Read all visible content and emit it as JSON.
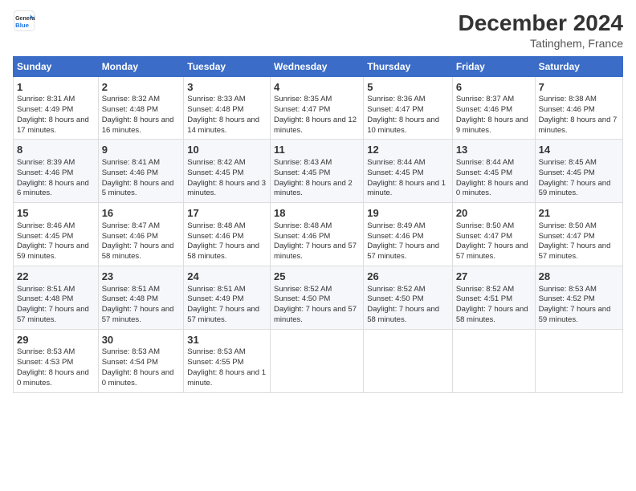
{
  "header": {
    "logo_line1": "General",
    "logo_line2": "Blue",
    "title": "December 2024",
    "subtitle": "Tatinghem, France"
  },
  "days_of_week": [
    "Sunday",
    "Monday",
    "Tuesday",
    "Wednesday",
    "Thursday",
    "Friday",
    "Saturday"
  ],
  "weeks": [
    [
      {
        "num": "1",
        "sunrise": "Sunrise: 8:31 AM",
        "sunset": "Sunset: 4:49 PM",
        "daylight": "Daylight: 8 hours and 17 minutes."
      },
      {
        "num": "2",
        "sunrise": "Sunrise: 8:32 AM",
        "sunset": "Sunset: 4:48 PM",
        "daylight": "Daylight: 8 hours and 16 minutes."
      },
      {
        "num": "3",
        "sunrise": "Sunrise: 8:33 AM",
        "sunset": "Sunset: 4:48 PM",
        "daylight": "Daylight: 8 hours and 14 minutes."
      },
      {
        "num": "4",
        "sunrise": "Sunrise: 8:35 AM",
        "sunset": "Sunset: 4:47 PM",
        "daylight": "Daylight: 8 hours and 12 minutes."
      },
      {
        "num": "5",
        "sunrise": "Sunrise: 8:36 AM",
        "sunset": "Sunset: 4:47 PM",
        "daylight": "Daylight: 8 hours and 10 minutes."
      },
      {
        "num": "6",
        "sunrise": "Sunrise: 8:37 AM",
        "sunset": "Sunset: 4:46 PM",
        "daylight": "Daylight: 8 hours and 9 minutes."
      },
      {
        "num": "7",
        "sunrise": "Sunrise: 8:38 AM",
        "sunset": "Sunset: 4:46 PM",
        "daylight": "Daylight: 8 hours and 7 minutes."
      }
    ],
    [
      {
        "num": "8",
        "sunrise": "Sunrise: 8:39 AM",
        "sunset": "Sunset: 4:46 PM",
        "daylight": "Daylight: 8 hours and 6 minutes."
      },
      {
        "num": "9",
        "sunrise": "Sunrise: 8:41 AM",
        "sunset": "Sunset: 4:46 PM",
        "daylight": "Daylight: 8 hours and 5 minutes."
      },
      {
        "num": "10",
        "sunrise": "Sunrise: 8:42 AM",
        "sunset": "Sunset: 4:45 PM",
        "daylight": "Daylight: 8 hours and 3 minutes."
      },
      {
        "num": "11",
        "sunrise": "Sunrise: 8:43 AM",
        "sunset": "Sunset: 4:45 PM",
        "daylight": "Daylight: 8 hours and 2 minutes."
      },
      {
        "num": "12",
        "sunrise": "Sunrise: 8:44 AM",
        "sunset": "Sunset: 4:45 PM",
        "daylight": "Daylight: 8 hours and 1 minute."
      },
      {
        "num": "13",
        "sunrise": "Sunrise: 8:44 AM",
        "sunset": "Sunset: 4:45 PM",
        "daylight": "Daylight: 8 hours and 0 minutes."
      },
      {
        "num": "14",
        "sunrise": "Sunrise: 8:45 AM",
        "sunset": "Sunset: 4:45 PM",
        "daylight": "Daylight: 7 hours and 59 minutes."
      }
    ],
    [
      {
        "num": "15",
        "sunrise": "Sunrise: 8:46 AM",
        "sunset": "Sunset: 4:45 PM",
        "daylight": "Daylight: 7 hours and 59 minutes."
      },
      {
        "num": "16",
        "sunrise": "Sunrise: 8:47 AM",
        "sunset": "Sunset: 4:46 PM",
        "daylight": "Daylight: 7 hours and 58 minutes."
      },
      {
        "num": "17",
        "sunrise": "Sunrise: 8:48 AM",
        "sunset": "Sunset: 4:46 PM",
        "daylight": "Daylight: 7 hours and 58 minutes."
      },
      {
        "num": "18",
        "sunrise": "Sunrise: 8:48 AM",
        "sunset": "Sunset: 4:46 PM",
        "daylight": "Daylight: 7 hours and 57 minutes."
      },
      {
        "num": "19",
        "sunrise": "Sunrise: 8:49 AM",
        "sunset": "Sunset: 4:46 PM",
        "daylight": "Daylight: 7 hours and 57 minutes."
      },
      {
        "num": "20",
        "sunrise": "Sunrise: 8:50 AM",
        "sunset": "Sunset: 4:47 PM",
        "daylight": "Daylight: 7 hours and 57 minutes."
      },
      {
        "num": "21",
        "sunrise": "Sunrise: 8:50 AM",
        "sunset": "Sunset: 4:47 PM",
        "daylight": "Daylight: 7 hours and 57 minutes."
      }
    ],
    [
      {
        "num": "22",
        "sunrise": "Sunrise: 8:51 AM",
        "sunset": "Sunset: 4:48 PM",
        "daylight": "Daylight: 7 hours and 57 minutes."
      },
      {
        "num": "23",
        "sunrise": "Sunrise: 8:51 AM",
        "sunset": "Sunset: 4:48 PM",
        "daylight": "Daylight: 7 hours and 57 minutes."
      },
      {
        "num": "24",
        "sunrise": "Sunrise: 8:51 AM",
        "sunset": "Sunset: 4:49 PM",
        "daylight": "Daylight: 7 hours and 57 minutes."
      },
      {
        "num": "25",
        "sunrise": "Sunrise: 8:52 AM",
        "sunset": "Sunset: 4:50 PM",
        "daylight": "Daylight: 7 hours and 57 minutes."
      },
      {
        "num": "26",
        "sunrise": "Sunrise: 8:52 AM",
        "sunset": "Sunset: 4:50 PM",
        "daylight": "Daylight: 7 hours and 58 minutes."
      },
      {
        "num": "27",
        "sunrise": "Sunrise: 8:52 AM",
        "sunset": "Sunset: 4:51 PM",
        "daylight": "Daylight: 7 hours and 58 minutes."
      },
      {
        "num": "28",
        "sunrise": "Sunrise: 8:53 AM",
        "sunset": "Sunset: 4:52 PM",
        "daylight": "Daylight: 7 hours and 59 minutes."
      }
    ],
    [
      {
        "num": "29",
        "sunrise": "Sunrise: 8:53 AM",
        "sunset": "Sunset: 4:53 PM",
        "daylight": "Daylight: 8 hours and 0 minutes."
      },
      {
        "num": "30",
        "sunrise": "Sunrise: 8:53 AM",
        "sunset": "Sunset: 4:54 PM",
        "daylight": "Daylight: 8 hours and 0 minutes."
      },
      {
        "num": "31",
        "sunrise": "Sunrise: 8:53 AM",
        "sunset": "Sunset: 4:55 PM",
        "daylight": "Daylight: 8 hours and 1 minute."
      },
      null,
      null,
      null,
      null
    ]
  ]
}
